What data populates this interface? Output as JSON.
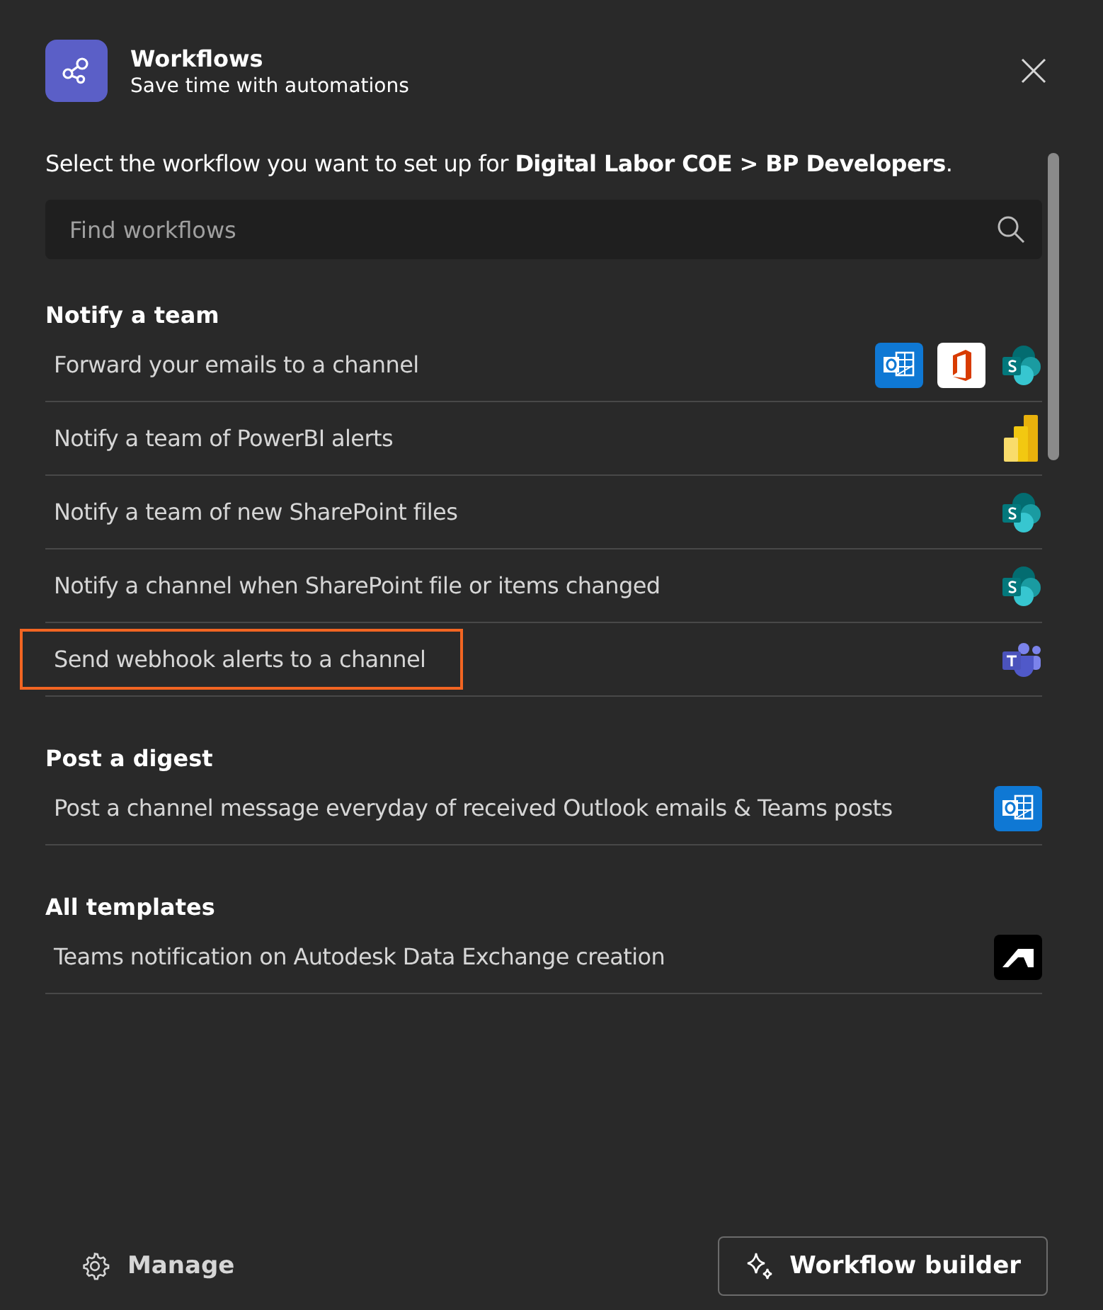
{
  "header": {
    "title": "Workflows",
    "subtitle": "Save time with automations"
  },
  "intro": "Select the workflow you want to set up for **Digital Labor COE > BP Developers**.",
  "search": {
    "placeholder": "Find workflows"
  },
  "sections": [
    {
      "heading": "Notify a team",
      "items": [
        {
          "label": "Forward your emails to a channel",
          "highlighted": false,
          "apps": [
            {
              "kind": "outlook"
            },
            {
              "kind": "office"
            },
            {
              "kind": "sharepoint"
            }
          ]
        },
        {
          "label": "Notify a team of PowerBI alerts",
          "highlighted": false,
          "apps": [
            {
              "kind": "powerbi"
            }
          ]
        },
        {
          "label": "Notify a team of new SharePoint files",
          "highlighted": false,
          "apps": [
            {
              "kind": "sharepoint"
            }
          ]
        },
        {
          "label": "Notify a channel when SharePoint file or items changed",
          "highlighted": false,
          "apps": [
            {
              "kind": "sharepoint"
            }
          ]
        },
        {
          "label": "Send webhook alerts to a channel",
          "highlighted": true,
          "apps": [
            {
              "kind": "teams"
            }
          ]
        }
      ]
    },
    {
      "heading": "Post a digest",
      "items": [
        {
          "label": "Post a channel message everyday of received Outlook emails & Teams posts",
          "highlighted": false,
          "apps": [
            {
              "kind": "outlook"
            }
          ]
        }
      ]
    },
    {
      "heading": "All templates",
      "items": [
        {
          "label": "Teams notification on Autodesk Data Exchange creation",
          "highlighted": false,
          "apps": [
            {
              "kind": "autodesk"
            }
          ]
        }
      ]
    }
  ],
  "footer": {
    "manage": "Manage",
    "builder": "Workflow builder"
  }
}
